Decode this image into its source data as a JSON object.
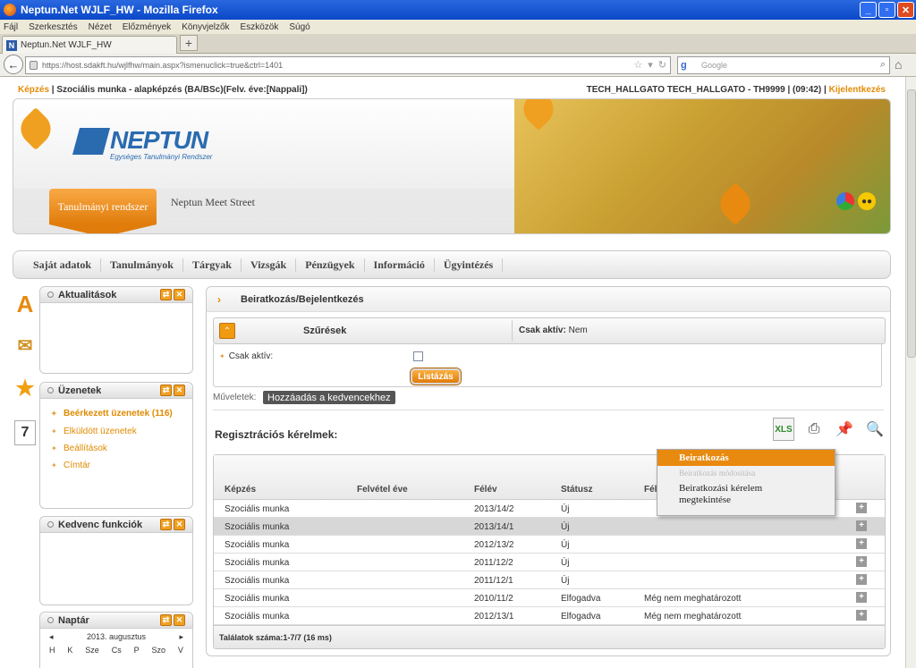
{
  "window": {
    "title": "Neptun.Net WJLF_HW - Mozilla Firefox"
  },
  "menubar": [
    "Fájl",
    "Szerkesztés",
    "Nézet",
    "Előzmények",
    "Könyvjelzők",
    "Eszközök",
    "Súgó"
  ],
  "tab": {
    "label": "Neptun.Net WJLF_HW"
  },
  "address": {
    "url": "https://host.sdakft.hu/wjlfhw/main.aspx?ismenuclick=true&ctrl=1401",
    "search_placeholder": "Google"
  },
  "header": {
    "training_label": "Képzés",
    "training_value": "Szociális munka - alapképzés (BA/BSc)(Felv. éve:[Nappali])",
    "user": "TECH_HALLGATO TECH_HALLGATO - TH9999",
    "time": "(09:42)",
    "logout": "Kijelentkezés"
  },
  "banner": {
    "logo": "NEPTUN",
    "logo_sub": "Egységes Tanulmányi Rendszer",
    "tab_active": "Tanulmányi rendszer",
    "tab_other": "Neptun Meet Street"
  },
  "mainnav": [
    "Saját adatok",
    "Tanulmányok",
    "Tárgyak",
    "Vizsgák",
    "Pénzügyek",
    "Információ",
    "Ügyintézés"
  ],
  "sidebar": {
    "news_title": "Aktualitások",
    "messages_title": "Üzenetek",
    "messages": [
      "Beérkezett üzenetek (116)",
      "Elküldött üzenetek",
      "Beállítások",
      "Címtár"
    ],
    "fav_title": "Kedvenc funkciók",
    "calendar_title": "Naptár",
    "calendar_month": "2013. augusztus",
    "calendar_days": [
      "H",
      "K",
      "Sze",
      "Cs",
      "P",
      "Szo",
      "V"
    ]
  },
  "panel": {
    "title": "Beiratkozás/Bejelentkezés",
    "filters_label": "Szűrések",
    "active_label": "Csak aktív:",
    "active_value": "Nem",
    "active_field": "Csak aktív:",
    "list_button": "Listázás",
    "ops_label": "Műveletek:",
    "fav_button": "Hozzáadás a kedvencekhez",
    "reg_title": "Regisztrációs kérelmek:",
    "columns": [
      "Képzés",
      "Felvétel éve",
      "Félév",
      "Státusz",
      "Fél"
    ],
    "rows": [
      {
        "kepzes": "Szociális munka",
        "felev": "2013/14/2",
        "statusz": "Új",
        "extra": ""
      },
      {
        "kepzes": "Szociális munka",
        "felev": "2013/14/1",
        "statusz": "Új",
        "extra": ""
      },
      {
        "kepzes": "Szociális munka",
        "felev": "2012/13/2",
        "statusz": "Új",
        "extra": ""
      },
      {
        "kepzes": "Szociális munka",
        "felev": "2011/12/2",
        "statusz": "Új",
        "extra": ""
      },
      {
        "kepzes": "Szociális munka",
        "felev": "2011/12/1",
        "statusz": "Új",
        "extra": ""
      },
      {
        "kepzes": "Szociális munka",
        "felev": "2010/11/2",
        "statusz": "Elfogadva",
        "extra": "Még nem meghatározott"
      },
      {
        "kepzes": "Szociális munka",
        "felev": "2012/13/1",
        "statusz": "Elfogadva",
        "extra": "Még nem meghatározott"
      }
    ],
    "footer": "Találatok száma:1-7/7 (16 ms)"
  },
  "context_menu": [
    "Beiratkozás",
    "Beiratkozás módosítása",
    "Beiratkozási kérelem megtekintése"
  ],
  "colors": {
    "accent": "#e38b07",
    "brand": "#2a6bb0"
  }
}
